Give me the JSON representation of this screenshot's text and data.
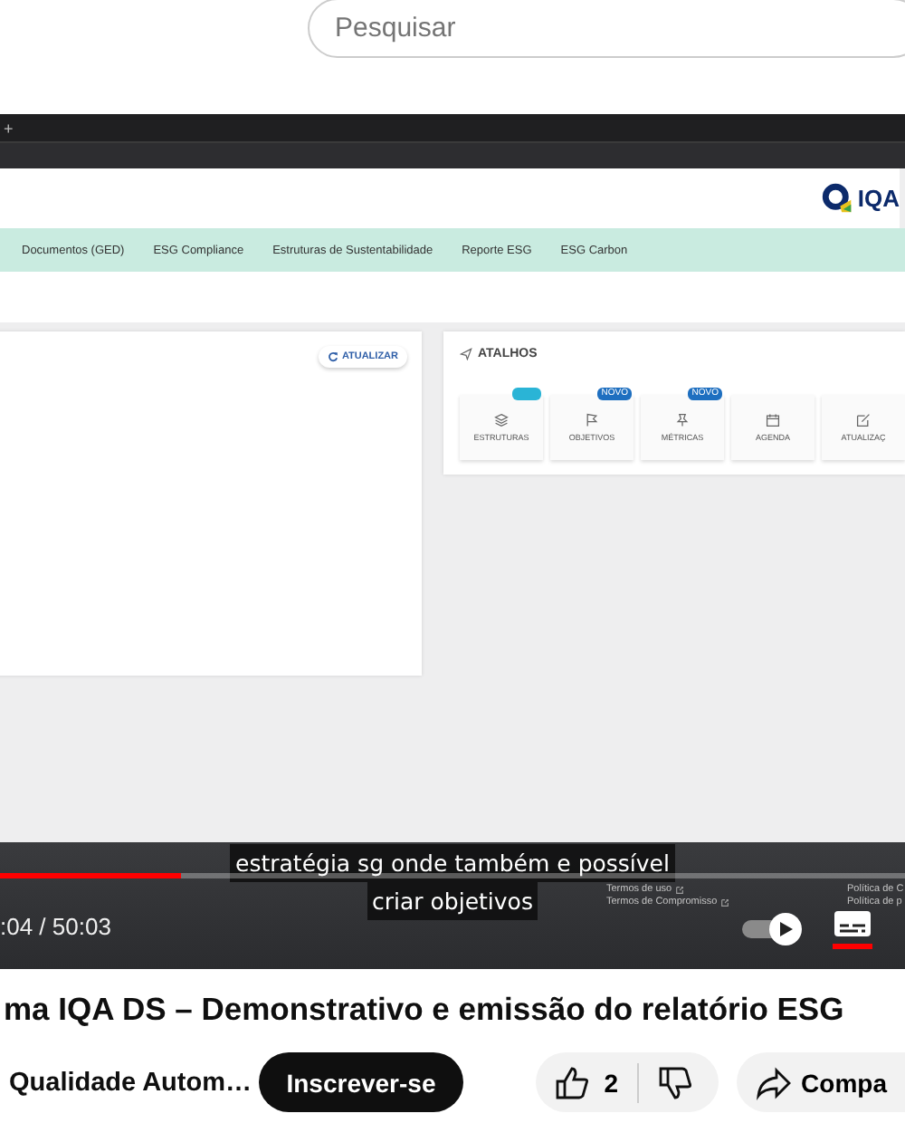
{
  "search": {
    "placeholder": "Pesquisar"
  },
  "video": {
    "browser": {
      "new_tab": "+"
    },
    "app": {
      "logo": "IQA",
      "nav": [
        "Documentos (GED)",
        "ESG Compliance",
        "Estruturas de Sustentabilidade",
        "Reporte ESG",
        "ESG Carbon"
      ],
      "refresh_button": "ATUALIZAR",
      "shortcuts_title": "ATALHOS",
      "shortcuts": [
        {
          "label": "ESTRUTURAS",
          "badge": {
            "color": "#2ab4d6"
          }
        },
        {
          "label": "OBJETIVOS",
          "badge": {
            "text": "NOVO",
            "color": "#1e6fc0"
          }
        },
        {
          "label": "MÉTRICAS",
          "badge": {
            "text": "NOVO",
            "color": "#1e6fc0"
          }
        },
        {
          "label": "AGENDA"
        },
        {
          "label": "ATUALIZAÇ"
        }
      ],
      "footer_links": [
        "Termos de uso",
        "Termos de Compromisso",
        "Política de C",
        "Política de p"
      ]
    },
    "captions": [
      "estratégia sg onde também e possível",
      "criar objetivos"
    ],
    "progress": {
      "level": 0.2
    },
    "time": ":04 / 50:03",
    "captions_button": {
      "on": true
    }
  },
  "title": "ma IQA DS – Demonstrativo e emissão do relatório ESG",
  "channel": "Qualidade Autom…",
  "subscribe": "Inscrever-se",
  "likes": "2",
  "share": "Compa"
}
